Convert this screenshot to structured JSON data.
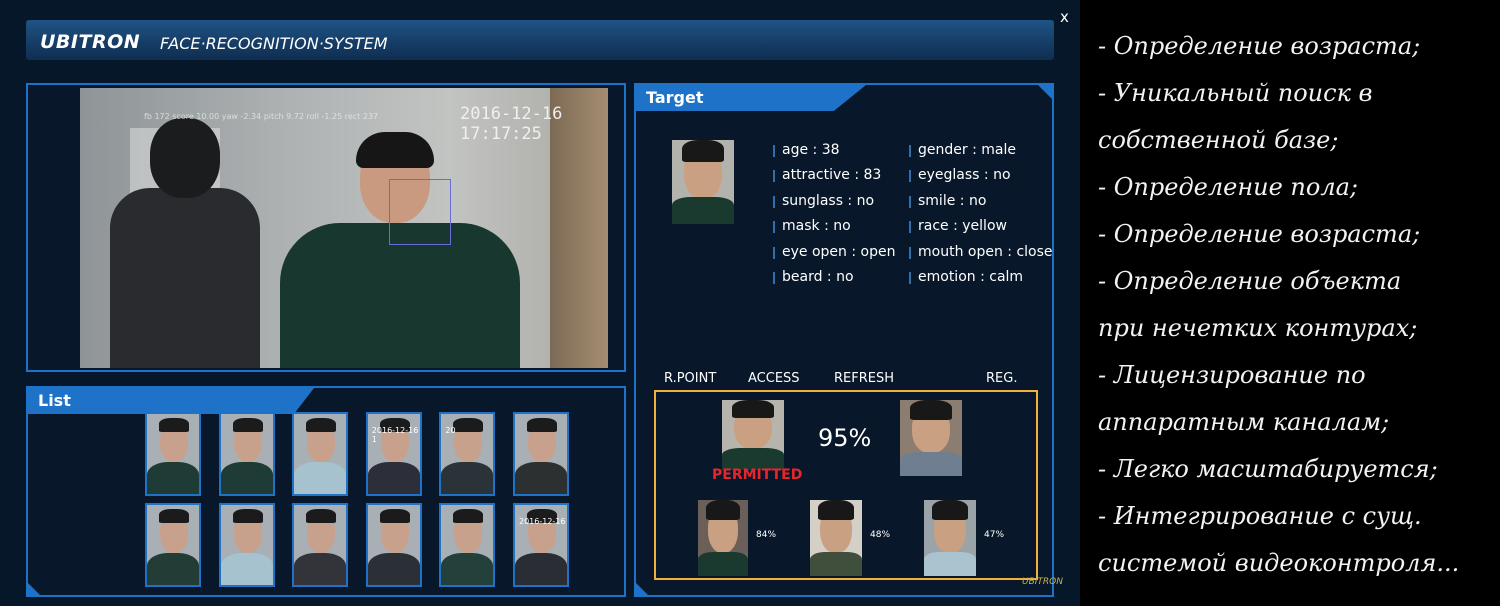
{
  "window": {
    "brand": "UBITRON",
    "title": "FACE·RECOGNITION·SYSTEM",
    "close_label": "x"
  },
  "video": {
    "timestamp": "2016-12-16 17:17:25",
    "osd": "fb 172 score 10.00 yaw -2.34 pitch 9.72 roll -1.25 rect 237"
  },
  "target": {
    "header": "Target",
    "attributes_left": [
      "age : 38",
      "attractive : 83",
      "sunglass : no",
      "mask : no",
      "eye open : open",
      "beard : no"
    ],
    "attributes_right": [
      "gender : male",
      "eyeglass : no",
      "smile : no",
      "race : yellow",
      "mouth open : close",
      "emotion : calm"
    ],
    "columns": [
      "R.POINT",
      "ACCESS",
      "REFRESH",
      "REG."
    ],
    "match_percent": "95%",
    "access_status": "PERMITTED",
    "candidates": [
      "84%",
      "48%",
      "47%"
    ],
    "footer_logo": "UBITRON"
  },
  "list": {
    "header": "List",
    "rows": 2,
    "cols": 6,
    "overlay_texts": [
      "2016-12-16 1",
      "20",
      "2016-12-16"
    ]
  },
  "features": [
    "- Определение возраста;",
    "- Уникальный поиск в",
    "собственной базе;",
    "- Определение пола;",
    "- Определение возраста;",
    "- Определение объекта",
    "при нечетких контурах;",
    "- Лицензирование по",
    "аппаратным каналам;",
    "- Легко масштабируется;",
    "- Интегрирование с сущ.",
    "системой видеоконтроля..."
  ],
  "colors": {
    "panel_border": "#1e72c8",
    "match_border": "#f0b13c",
    "permitted": "#e6262b",
    "background": "#06172a"
  }
}
